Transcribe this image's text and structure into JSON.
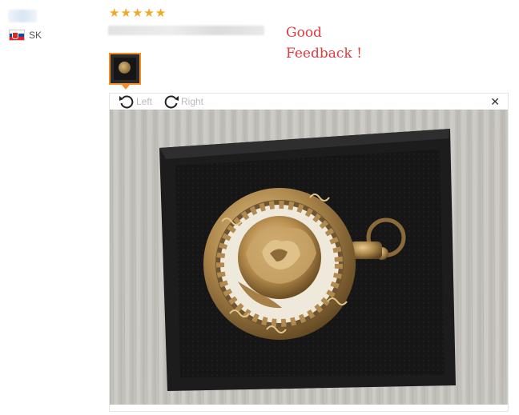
{
  "reviewer": {
    "country_code": "SK",
    "flag_colors": [
      "#ffffff",
      "#0b4ea2",
      "#ee1c25"
    ]
  },
  "rating": {
    "stars": 5,
    "star_color": "#f5a623",
    "star_glyph": "★"
  },
  "review": {
    "text": "Good\nFeedback !",
    "text_color": "#e0393e"
  },
  "thumbnail": {
    "selected": true,
    "border_color": "#f28c28"
  },
  "viewer": {
    "rotate_left_label": "Left",
    "rotate_right_label": "Right",
    "close_glyph": "✕",
    "rotate_left_icon": "rotate-left-icon",
    "rotate_right_icon": "rotate-right-icon"
  }
}
